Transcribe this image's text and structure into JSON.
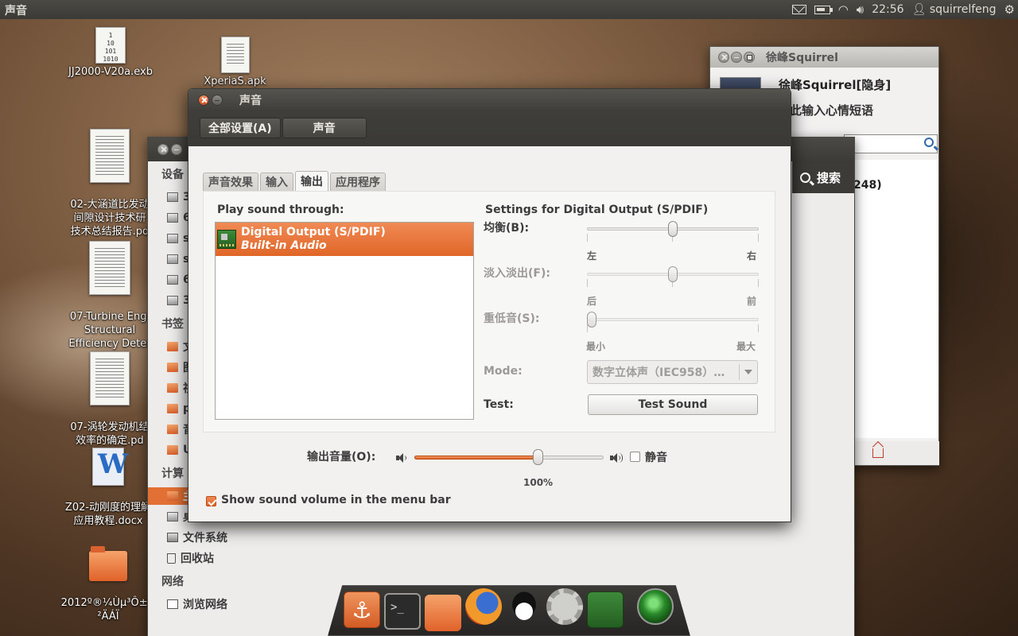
{
  "top_panel": {
    "app_title": "声音",
    "clock": "22:56",
    "user": "squirrelfeng"
  },
  "desktop_icons": [
    {
      "label": "JJ2000-V20a.exb",
      "glyph": "binary-file-icon"
    },
    {
      "label": "XperiaS.apk",
      "glyph": "text-file-icon"
    },
    {
      "label": "02-大涵道比发动\n间隙设计技术研\n技术总结报告.pd",
      "glyph": "pdf-file-icon"
    },
    {
      "label": "07-Turbine Engi\nStructural\nEfficiency Deter",
      "glyph": "pdf-file-icon"
    },
    {
      "label": "07-涡轮发动机结\n效率的确定.pd",
      "glyph": "pdf-file-icon"
    },
    {
      "label": "Z02-动刚度的理解\n应用教程.docx",
      "glyph": "word-file-icon"
    },
    {
      "label": "2012º®¼Ùµ³Ô±Ñ\n²ÄÁÏ",
      "glyph": "folder-icon"
    }
  ],
  "bin_glyph_text": "1\n10\n101\n1010",
  "qq_window": {
    "title": "徐峰Squirrel",
    "name": "徐峰Squirrel[隐身]",
    "mood": "此输入心情短语",
    "count": "248)"
  },
  "nautilus": {
    "search_label": "搜索",
    "headers": {
      "devices": "设备",
      "bookmarks": "书签",
      "computer": "计算",
      "network": "网络"
    },
    "devices": [
      "3",
      "6",
      "s",
      "s",
      "6",
      "3"
    ],
    "bookmarks": [
      "文",
      "图",
      "视",
      "p",
      "音",
      "U"
    ],
    "computer": [
      {
        "label": "主",
        "icon": "home-folder-icon",
        "selected": true
      },
      {
        "label": "桌",
        "icon": "desktop-icon",
        "selected": false
      },
      {
        "label": "文件系统",
        "icon": "filesystem-icon",
        "selected": false
      },
      {
        "label": "回收站",
        "icon": "trash-icon",
        "selected": false
      }
    ],
    "network": [
      {
        "label": "浏览网络",
        "icon": "network-icon"
      }
    ]
  },
  "sound_window": {
    "title": "声音",
    "breadcrumbs": [
      "全部设置(A)",
      "声音"
    ],
    "tabs": [
      {
        "label": "声音效果",
        "active": false
      },
      {
        "label": "输入",
        "active": false
      },
      {
        "label": "输出",
        "active": true
      },
      {
        "label": "应用程序",
        "active": false
      }
    ],
    "play_through_label": "Play sound through:",
    "device": {
      "name": "Digital Output (S/PDIF)",
      "sub": "Built-in Audio"
    },
    "settings_title": "Settings for Digital Output (S/PDIF)",
    "balance": {
      "label": "均衡(B):",
      "left": "左",
      "right": "右",
      "value": 0.5
    },
    "fade": {
      "label": "淡入淡出(F):",
      "left": "后",
      "right": "前",
      "value": 0.5
    },
    "subwoofer": {
      "label": "重低音(S):",
      "left": "最小",
      "right": "最大",
      "value": 0.0
    },
    "mode": {
      "label": "Mode:",
      "value": "数字立体声（IEC958）…"
    },
    "test": {
      "label": "Test:",
      "button": "Test Sound"
    },
    "output_volume": {
      "label": "输出音量(O):",
      "percent_text": "100%",
      "value": 0.65
    },
    "mute_label": "静音",
    "mute_checked": false,
    "show_in_menubar_label": "Show sound volume in the menu bar",
    "show_in_menubar_checked": true
  },
  "dock_items": [
    "anchor-icon",
    "terminal-icon",
    "home-folder-icon",
    "firefox-icon",
    "qq-icon",
    "settings-icon",
    "network-card-icon",
    "green-orb-icon"
  ],
  "colors": {
    "accent": "#e06628",
    "panel": "#3c3b37",
    "window_bg": "#f2f1f0"
  }
}
